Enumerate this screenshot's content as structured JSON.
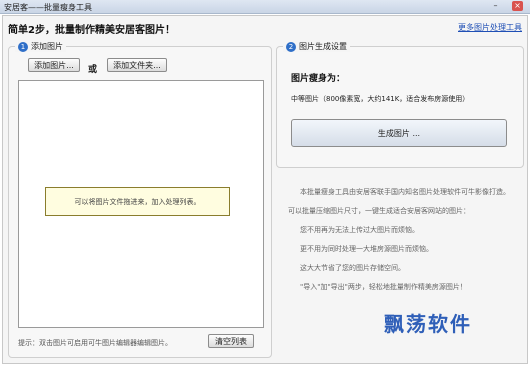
{
  "window": {
    "title": "安居客——批量瘦身工具",
    "min_label": "–",
    "close_label": "×"
  },
  "header": {
    "heading": "简单2步，批量制作精美安居客图片！",
    "more_link": "更多图片处理工具"
  },
  "left_panel": {
    "step_number": "1",
    "title": "添加图片",
    "add_image_button": "添加图片...",
    "or_text": "或",
    "add_folder_button": "添加文件夹...",
    "hint": "可以将图片文件拖进来，加入处理列表。",
    "tip": "提示：双击图片可启用可牛图片编辑器编辑图片。",
    "clear_button": "清空列表"
  },
  "right_panel": {
    "step_number": "2",
    "title": "图片生成设置",
    "size_label": "图片瘦身为：",
    "size_value": "中等图片（800像素宽，大约141K，适合发布房源使用）",
    "generate_button": "生成图片 ..."
  },
  "description": {
    "lines": [
      "本批量瘦身工具由安居客联手国内知名图片处理软件可牛影像打造。",
      "可以批量压缩图片尺寸，一键生成适合安居客网站的图片：",
      "您不用再为无法上传过大图片而烦恼。",
      "更不用为同时处理一大堆房源图片而烦恼。",
      "这大大节省了您的图片存储空间。",
      "\"导入\"加\"导出\"两步，轻松地批量制作精美房源图片！"
    ]
  },
  "watermark": "飘荡软件"
}
